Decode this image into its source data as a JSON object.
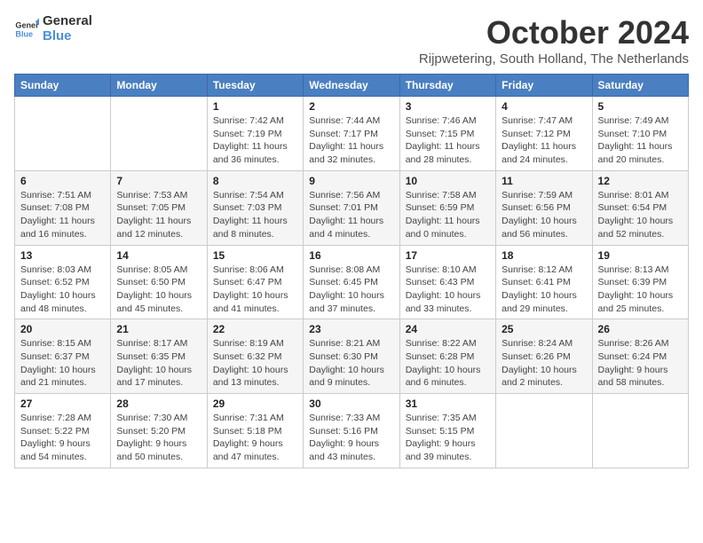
{
  "logo": {
    "line1": "General",
    "line2": "Blue"
  },
  "title": "October 2024",
  "location": "Rijpwetering, South Holland, The Netherlands",
  "weekdays": [
    "Sunday",
    "Monday",
    "Tuesday",
    "Wednesday",
    "Thursday",
    "Friday",
    "Saturday"
  ],
  "weeks": [
    [
      {
        "day": "",
        "info": ""
      },
      {
        "day": "",
        "info": ""
      },
      {
        "day": "1",
        "info": "Sunrise: 7:42 AM\nSunset: 7:19 PM\nDaylight: 11 hours and 36 minutes."
      },
      {
        "day": "2",
        "info": "Sunrise: 7:44 AM\nSunset: 7:17 PM\nDaylight: 11 hours and 32 minutes."
      },
      {
        "day": "3",
        "info": "Sunrise: 7:46 AM\nSunset: 7:15 PM\nDaylight: 11 hours and 28 minutes."
      },
      {
        "day": "4",
        "info": "Sunrise: 7:47 AM\nSunset: 7:12 PM\nDaylight: 11 hours and 24 minutes."
      },
      {
        "day": "5",
        "info": "Sunrise: 7:49 AM\nSunset: 7:10 PM\nDaylight: 11 hours and 20 minutes."
      }
    ],
    [
      {
        "day": "6",
        "info": "Sunrise: 7:51 AM\nSunset: 7:08 PM\nDaylight: 11 hours and 16 minutes."
      },
      {
        "day": "7",
        "info": "Sunrise: 7:53 AM\nSunset: 7:05 PM\nDaylight: 11 hours and 12 minutes."
      },
      {
        "day": "8",
        "info": "Sunrise: 7:54 AM\nSunset: 7:03 PM\nDaylight: 11 hours and 8 minutes."
      },
      {
        "day": "9",
        "info": "Sunrise: 7:56 AM\nSunset: 7:01 PM\nDaylight: 11 hours and 4 minutes."
      },
      {
        "day": "10",
        "info": "Sunrise: 7:58 AM\nSunset: 6:59 PM\nDaylight: 11 hours and 0 minutes."
      },
      {
        "day": "11",
        "info": "Sunrise: 7:59 AM\nSunset: 6:56 PM\nDaylight: 10 hours and 56 minutes."
      },
      {
        "day": "12",
        "info": "Sunrise: 8:01 AM\nSunset: 6:54 PM\nDaylight: 10 hours and 52 minutes."
      }
    ],
    [
      {
        "day": "13",
        "info": "Sunrise: 8:03 AM\nSunset: 6:52 PM\nDaylight: 10 hours and 48 minutes."
      },
      {
        "day": "14",
        "info": "Sunrise: 8:05 AM\nSunset: 6:50 PM\nDaylight: 10 hours and 45 minutes."
      },
      {
        "day": "15",
        "info": "Sunrise: 8:06 AM\nSunset: 6:47 PM\nDaylight: 10 hours and 41 minutes."
      },
      {
        "day": "16",
        "info": "Sunrise: 8:08 AM\nSunset: 6:45 PM\nDaylight: 10 hours and 37 minutes."
      },
      {
        "day": "17",
        "info": "Sunrise: 8:10 AM\nSunset: 6:43 PM\nDaylight: 10 hours and 33 minutes."
      },
      {
        "day": "18",
        "info": "Sunrise: 8:12 AM\nSunset: 6:41 PM\nDaylight: 10 hours and 29 minutes."
      },
      {
        "day": "19",
        "info": "Sunrise: 8:13 AM\nSunset: 6:39 PM\nDaylight: 10 hours and 25 minutes."
      }
    ],
    [
      {
        "day": "20",
        "info": "Sunrise: 8:15 AM\nSunset: 6:37 PM\nDaylight: 10 hours and 21 minutes."
      },
      {
        "day": "21",
        "info": "Sunrise: 8:17 AM\nSunset: 6:35 PM\nDaylight: 10 hours and 17 minutes."
      },
      {
        "day": "22",
        "info": "Sunrise: 8:19 AM\nSunset: 6:32 PM\nDaylight: 10 hours and 13 minutes."
      },
      {
        "day": "23",
        "info": "Sunrise: 8:21 AM\nSunset: 6:30 PM\nDaylight: 10 hours and 9 minutes."
      },
      {
        "day": "24",
        "info": "Sunrise: 8:22 AM\nSunset: 6:28 PM\nDaylight: 10 hours and 6 minutes."
      },
      {
        "day": "25",
        "info": "Sunrise: 8:24 AM\nSunset: 6:26 PM\nDaylight: 10 hours and 2 minutes."
      },
      {
        "day": "26",
        "info": "Sunrise: 8:26 AM\nSunset: 6:24 PM\nDaylight: 9 hours and 58 minutes."
      }
    ],
    [
      {
        "day": "27",
        "info": "Sunrise: 7:28 AM\nSunset: 5:22 PM\nDaylight: 9 hours and 54 minutes."
      },
      {
        "day": "28",
        "info": "Sunrise: 7:30 AM\nSunset: 5:20 PM\nDaylight: 9 hours and 50 minutes."
      },
      {
        "day": "29",
        "info": "Sunrise: 7:31 AM\nSunset: 5:18 PM\nDaylight: 9 hours and 47 minutes."
      },
      {
        "day": "30",
        "info": "Sunrise: 7:33 AM\nSunset: 5:16 PM\nDaylight: 9 hours and 43 minutes."
      },
      {
        "day": "31",
        "info": "Sunrise: 7:35 AM\nSunset: 5:15 PM\nDaylight: 9 hours and 39 minutes."
      },
      {
        "day": "",
        "info": ""
      },
      {
        "day": "",
        "info": ""
      }
    ]
  ]
}
